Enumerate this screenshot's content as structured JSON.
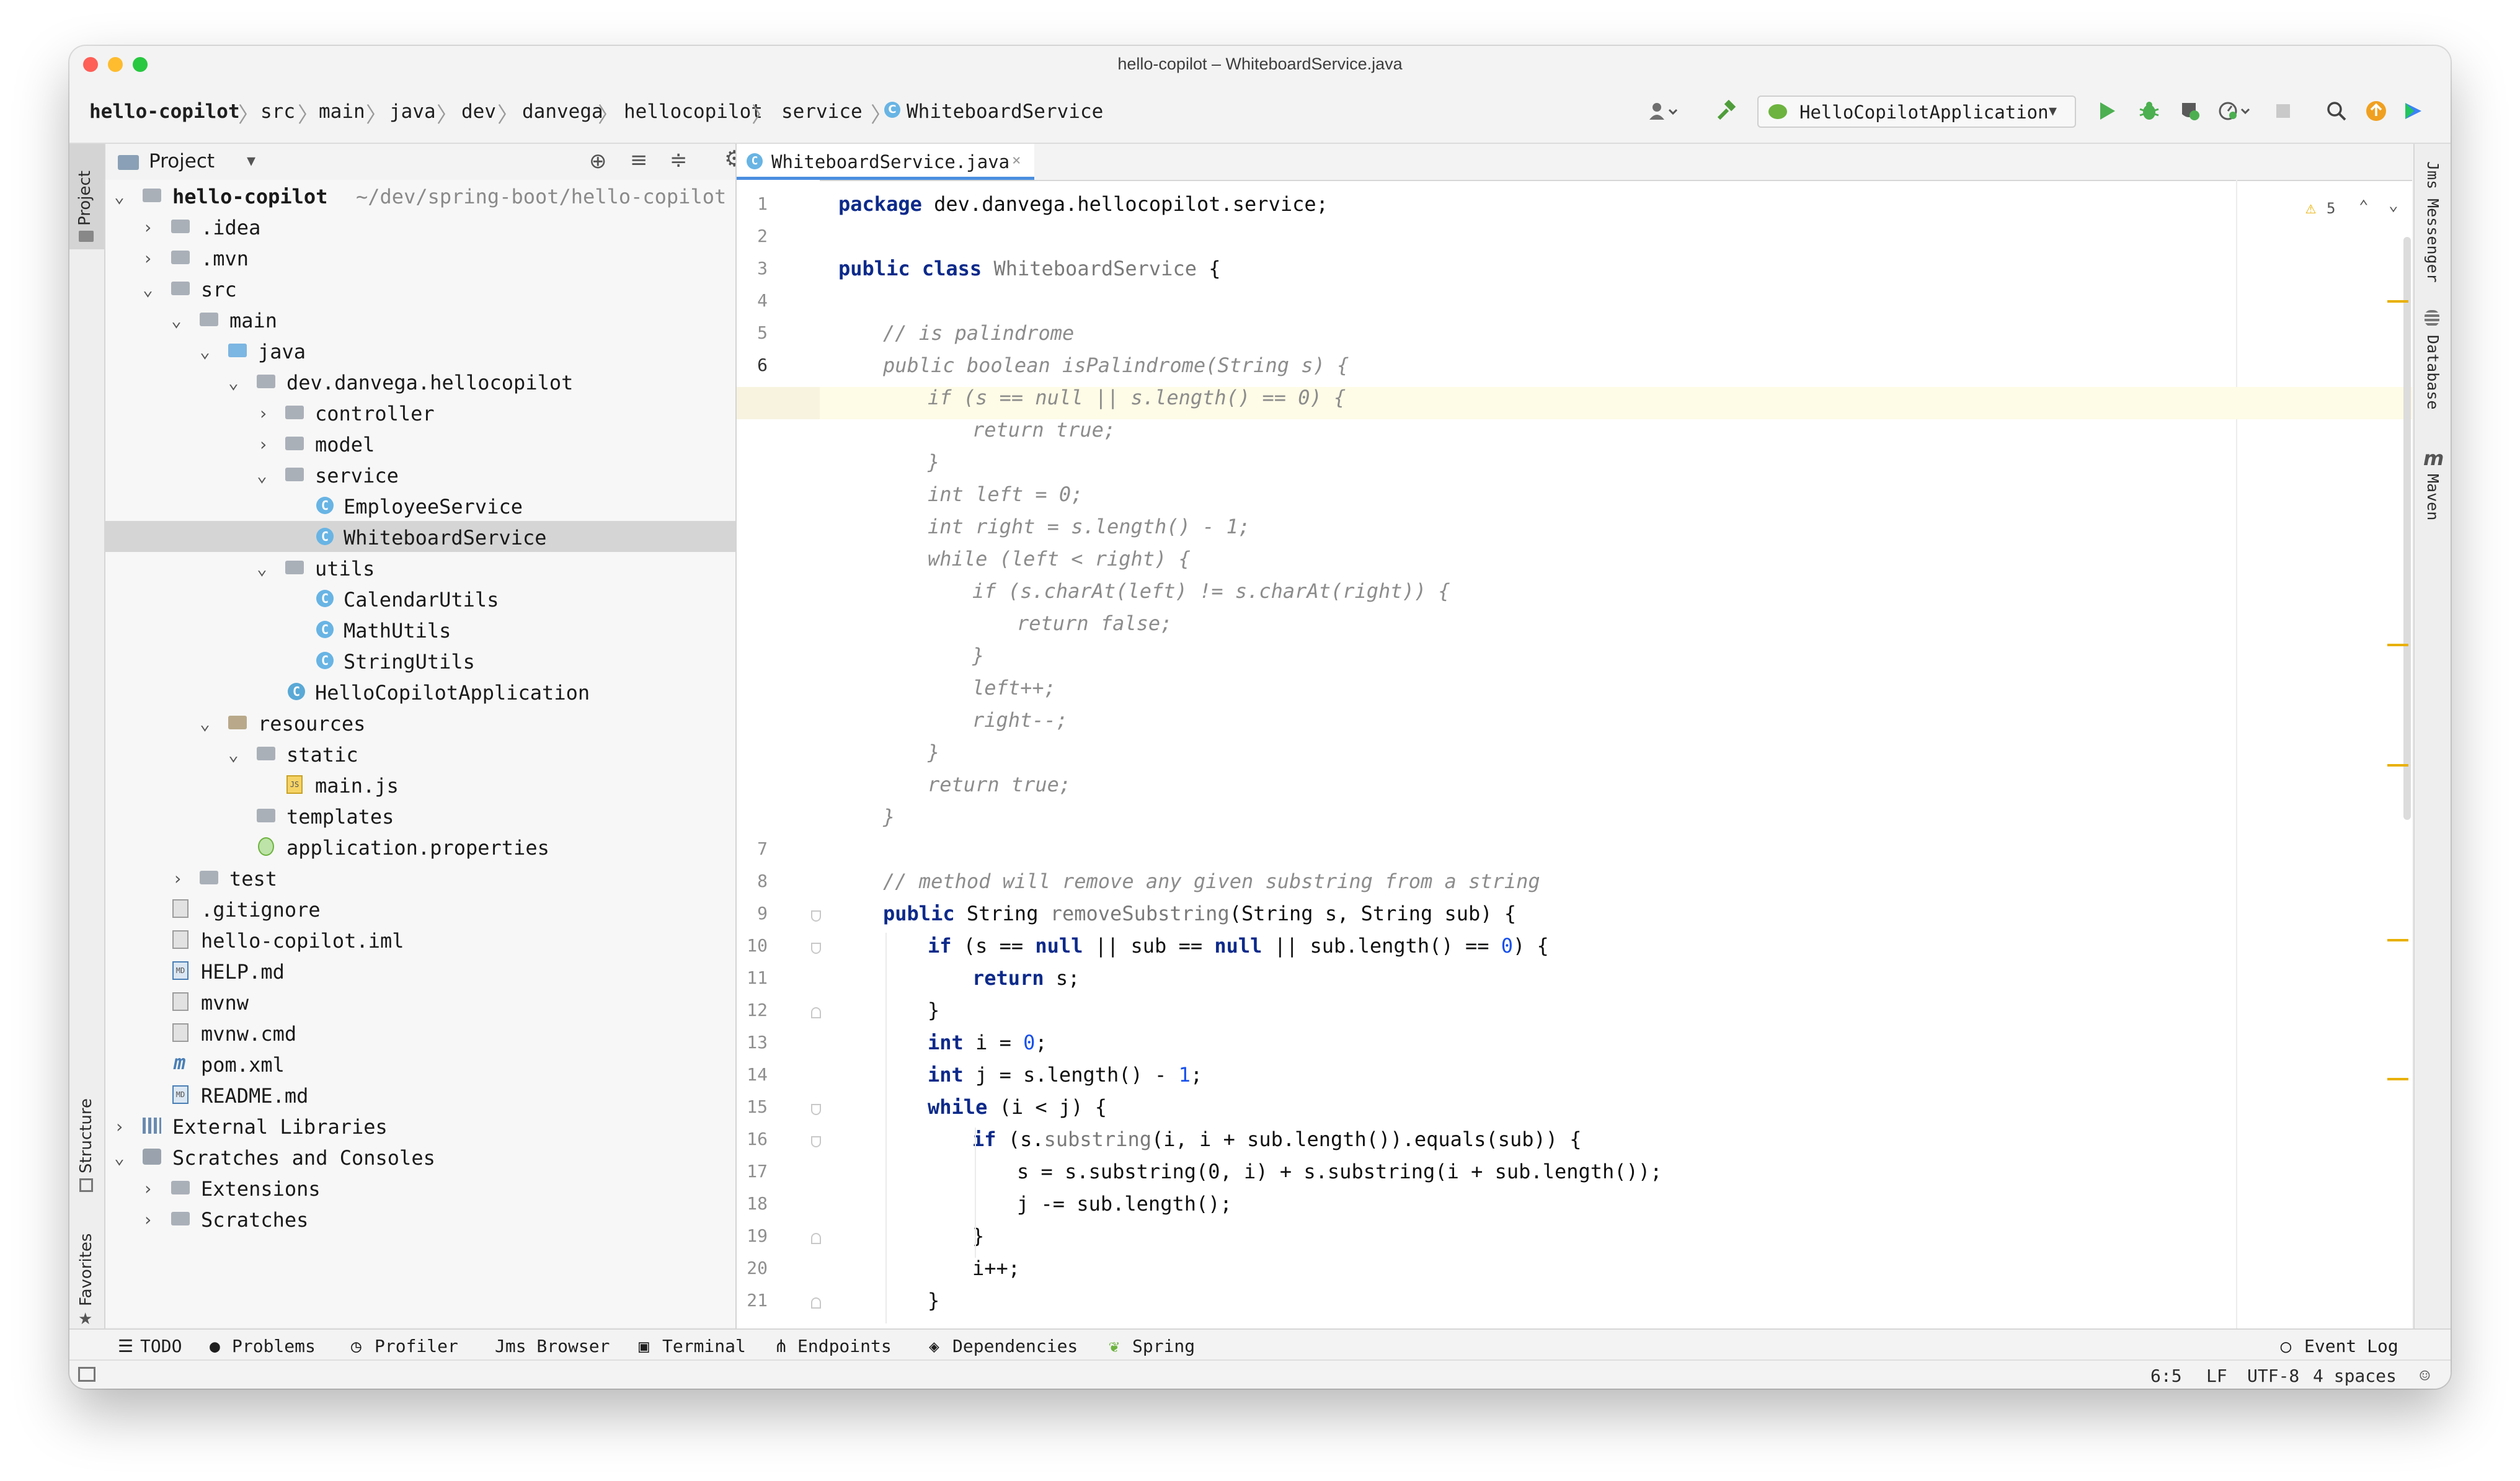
{
  "window": {
    "title": "hello-copilot – WhiteboardService.java"
  },
  "breadcrumb": [
    "hello-copilot",
    "src",
    "main",
    "java",
    "dev",
    "danvega",
    "hellocopilot",
    "service",
    "WhiteboardService"
  ],
  "toolbar": {
    "run_config": "HelloCopilotApplication"
  },
  "left_stripe": {
    "project": "Project",
    "structure": "Structure",
    "favorites": "Favorites"
  },
  "right_stripe": {
    "jms": "Jms Messenger",
    "database": "Database",
    "maven": "Maven",
    "maven_glyph": "m"
  },
  "project_panel": {
    "title": "Project",
    "root": {
      "name": "hello-copilot",
      "path": "~/dev/spring-boot/hello-copilot"
    },
    "items": [
      {
        "label": ".idea"
      },
      {
        "label": ".mvn"
      },
      {
        "label": "src"
      },
      {
        "label": "main"
      },
      {
        "label": "java"
      },
      {
        "label": "dev.danvega.hellocopilot"
      },
      {
        "label": "controller"
      },
      {
        "label": "model"
      },
      {
        "label": "service"
      },
      {
        "label": "EmployeeService"
      },
      {
        "label": "WhiteboardService"
      },
      {
        "label": "utils"
      },
      {
        "label": "CalendarUtils"
      },
      {
        "label": "MathUtils"
      },
      {
        "label": "StringUtils"
      },
      {
        "label": "HelloCopilotApplication"
      },
      {
        "label": "resources"
      },
      {
        "label": "static"
      },
      {
        "label": "main.js"
      },
      {
        "label": "templates"
      },
      {
        "label": "application.properties"
      },
      {
        "label": "test"
      },
      {
        "label": ".gitignore"
      },
      {
        "label": "hello-copilot.iml"
      },
      {
        "label": "HELP.md"
      },
      {
        "label": "mvnw"
      },
      {
        "label": "mvnw.cmd"
      },
      {
        "label": "pom.xml"
      },
      {
        "label": "README.md"
      },
      {
        "label": "External Libraries"
      },
      {
        "label": "Scratches and Consoles"
      },
      {
        "label": "Extensions"
      },
      {
        "label": "Scratches"
      }
    ],
    "icon_texts": {
      "md": "MD",
      "js": "JS",
      "class": "C"
    }
  },
  "editor": {
    "tab_label": "WhiteboardService.java",
    "warnings_count": "5",
    "line_numbers": [
      "1",
      "2",
      "3",
      "4",
      "5",
      "6",
      "7",
      "8",
      "9",
      "10",
      "11",
      "12",
      "13",
      "14",
      "15",
      "16",
      "17",
      "18",
      "19",
      "20",
      "21"
    ],
    "code": {
      "l1_kw": "package",
      "l1_rest": " dev.danvega.hellocopilot.service;",
      "l3_kw1": "public",
      "l3_kw2": "class",
      "l3_name": "WhiteboardService",
      "l3_rest": " {",
      "l5": "// is palindrome",
      "l6": "public boolean isPalindrome(String s) {",
      "g1": "if (s == null || s.length() == 0) {",
      "g2": "return true;",
      "g3": "}",
      "g4": "int left = 0;",
      "g5": "int right = s.length() - 1;",
      "g6": "while (left < right) {",
      "g7": "if (s.charAt(left) != s.charAt(right)) {",
      "g8": "return false;",
      "g9": "}",
      "g10": "left++;",
      "g11": "right--;",
      "g12": "}",
      "g13": "return true;",
      "g14": "}",
      "l8": "// method will remove any given substring from a string",
      "l9_a": "public",
      "l9_b": " String ",
      "l9_c": "removeSubstring",
      "l9_d": "(String s, String sub) {",
      "l10_a": "if",
      "l10_b": " (s == ",
      "l10_c": "null",
      "l10_d": " || sub == ",
      "l10_e": "null",
      "l10_f": " || sub.length() == ",
      "l10_g": "0",
      "l10_h": ") {",
      "l11_a": "return",
      "l11_b": " s;",
      "l12": "}",
      "l13_a": "int",
      "l13_b": " i = ",
      "l13_c": "0",
      "l13_d": ";",
      "l14_a": "int",
      "l14_b": " j = s.length() - ",
      "l14_c": "1",
      "l14_d": ";",
      "l15_a": "while",
      "l15_b": " (i < j) {",
      "l16_a": "if",
      "l16_b": " (s.",
      "l16_c": "substring",
      "l16_d": "(i, i + sub.length()).equals(sub)) {",
      "l17": "s = s.substring(0, i) + s.substring(i + sub.length());",
      "l18": "j -= sub.length();",
      "l19": "}",
      "l20": "i++;",
      "l21": "}"
    }
  },
  "bottom_tools": [
    "TODO",
    "Problems",
    "Profiler",
    "Jms Browser",
    "Terminal",
    "Endpoints",
    "Dependencies",
    "Spring",
    "Event Log"
  ],
  "status": {
    "position": "6:5",
    "line_sep": "LF",
    "encoding": "UTF-8",
    "indent": "4 spaces"
  }
}
